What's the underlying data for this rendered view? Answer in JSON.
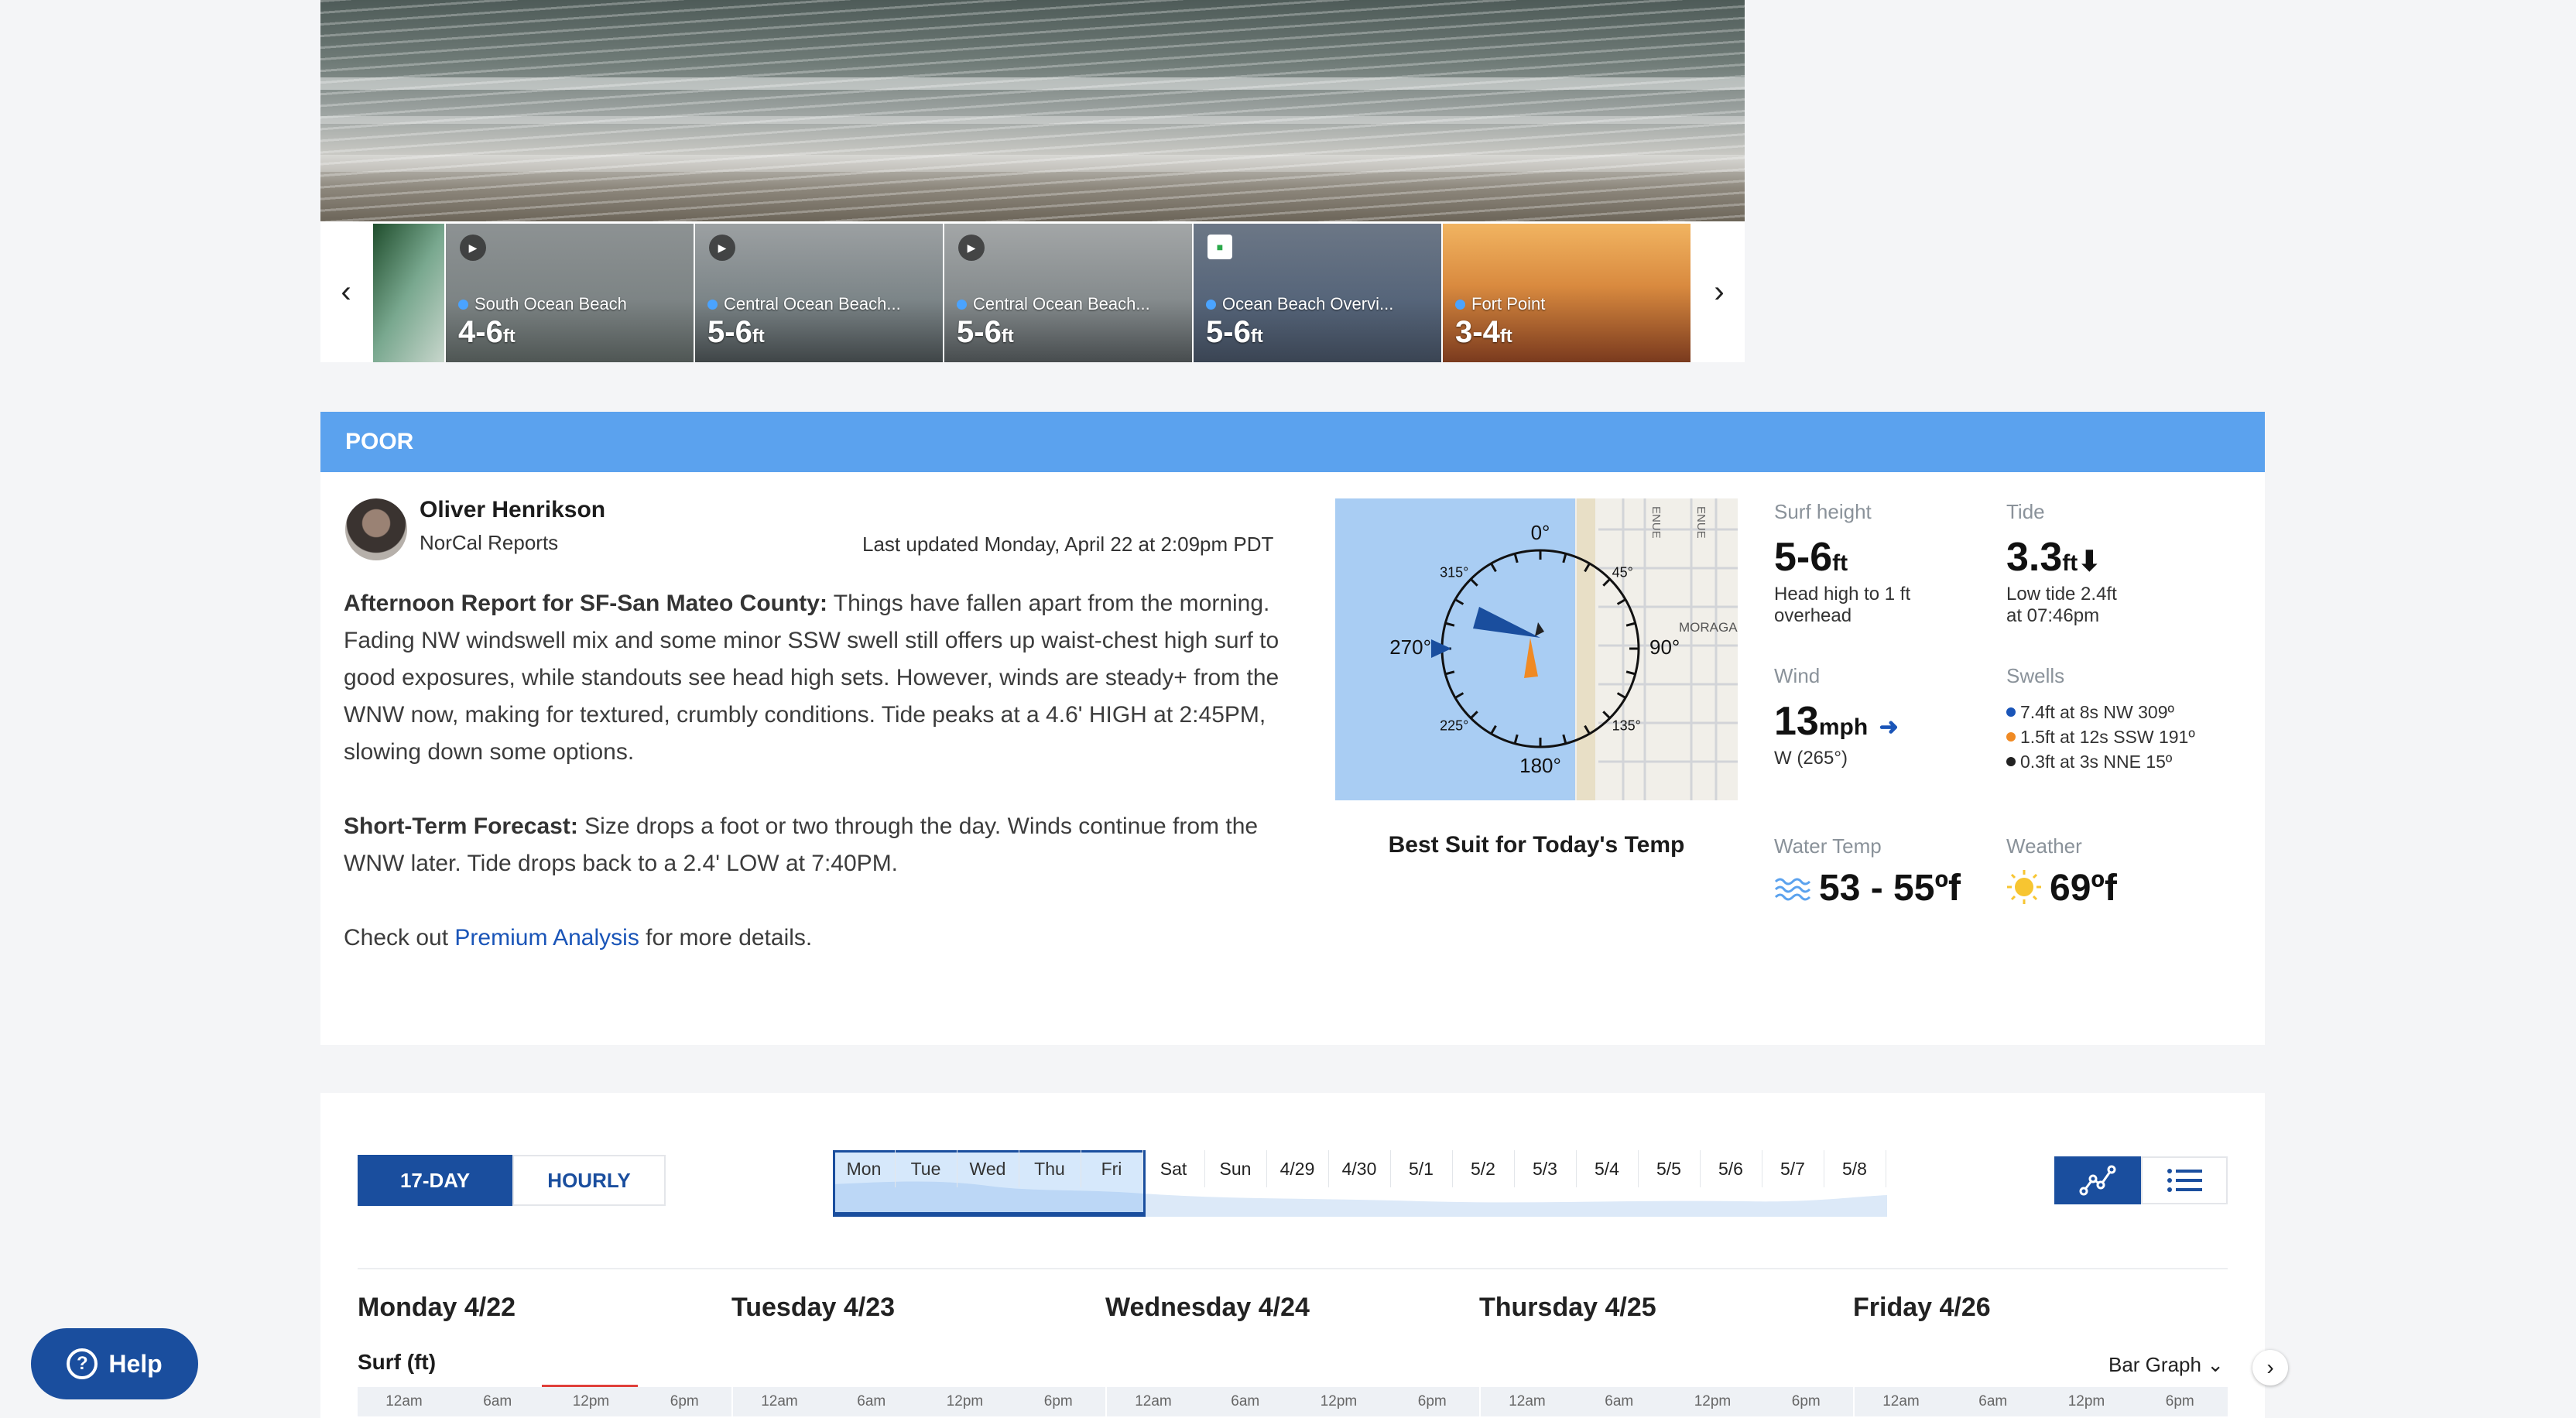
{
  "cams": [
    {
      "name": "South Ocean Beach",
      "size": "4-6",
      "unit": "ft",
      "icon": "play-icon"
    },
    {
      "name": "Central Ocean Beach...",
      "size": "5-6",
      "unit": "ft",
      "icon": "play-icon"
    },
    {
      "name": "Central Ocean Beach...",
      "size": "5-6",
      "unit": "ft",
      "icon": "play-icon"
    },
    {
      "name": "Ocean Beach Overvi...",
      "size": "5-6",
      "unit": "ft",
      "icon": "camera-flag-icon"
    },
    {
      "name": "Fort Point",
      "size": "3-4",
      "unit": "ft",
      "icon": "none"
    }
  ],
  "report": {
    "condition": "POOR",
    "author": "Oliver Henrikson",
    "author_sub": "NorCal Reports",
    "updated": "Last updated Monday, April 22 at 2:09pm PDT",
    "p1_label": "Afternoon Report for SF-San Mateo County:",
    "p1_text": " Things have fallen apart from the morning. Fading NW windswell mix and some minor SSW swell still offers up waist-chest high surf to good exposures, while standouts see head high sets.  However, winds are steady+ from the WNW now, making for textured, crumbly conditions.  Tide peaks at a 4.6' HIGH at 2:45PM, slowing down some options.",
    "p2_label": "Short-Term Forecast:",
    "p2_text": " Size drops a foot or two through the day.  Winds continue from the WNW later. Tide drops back to a 2.4' LOW at 7:40PM.",
    "p3_pre": "Check out ",
    "p3_link": "Premium Analysis",
    "p3_post": " for more details."
  },
  "map": {
    "caption": "Best Suit for Today's Temp",
    "street_labels": [
      "ENUE",
      "ENUE",
      "MORAGA"
    ],
    "compass": [
      "0°",
      "45°",
      "90°",
      "135°",
      "180°",
      "225°",
      "270°",
      "315°"
    ]
  },
  "conditions": {
    "surf": {
      "label": "Surf height",
      "value": "5-6",
      "unit": "ft",
      "desc_1": "Head high to 1 ft",
      "desc_2": "overhead"
    },
    "tide": {
      "label": "Tide",
      "value": "3.3",
      "unit": "ft",
      "arrow": "⬇",
      "desc_1": "Low tide 2.4ft",
      "desc_2": "at 07:46pm"
    },
    "wind": {
      "label": "Wind",
      "value": "13",
      "unit": "mph",
      "arrow": "➜",
      "desc": "W (265°)"
    },
    "swells": {
      "label": "Swells",
      "items": [
        {
          "text": "7.4ft at 8s NW 309º",
          "color": "#1a55b8"
        },
        {
          "text": "1.5ft at 12s SSW 191º",
          "color": "#f08a24"
        },
        {
          "text": "0.3ft at 3s NNE 15º",
          "color": "#222222"
        }
      ]
    },
    "water": {
      "label": "Water Temp",
      "value": "53 - 55",
      "unit": "ºf"
    },
    "weather": {
      "label": "Weather",
      "value": "69",
      "unit": "ºf"
    }
  },
  "forecast": {
    "tab_17": "17-DAY",
    "tab_hourly": "HOURLY",
    "days": [
      "Mon",
      "Tue",
      "Wed",
      "Thu",
      "Fri",
      "Sat",
      "Sun",
      "4/29",
      "4/30",
      "5/1",
      "5/2",
      "5/3",
      "5/4",
      "5/5",
      "5/6",
      "5/7",
      "5/8"
    ],
    "selected_days": 5,
    "day_titles": [
      "Monday 4/22",
      "Tuesday 4/23",
      "Wednesday 4/24",
      "Thursday 4/25",
      "Friday 4/26"
    ],
    "surf_label": "Surf (ft)",
    "graph_type": "Bar Graph",
    "hours": [
      "12am",
      "6am",
      "12pm",
      "6pm"
    ]
  },
  "help": "Help"
}
